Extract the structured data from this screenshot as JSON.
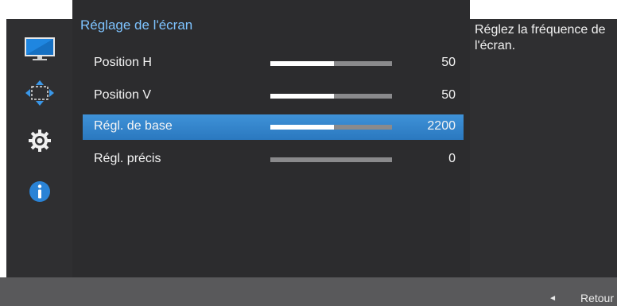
{
  "menu": {
    "title": "Réglage de l'écran",
    "items": [
      {
        "label": "Position H",
        "value": "50",
        "level": 0.52,
        "selected": false
      },
      {
        "label": "Position V",
        "value": "50",
        "level": 0.52,
        "selected": false
      },
      {
        "label": "Régl. de base",
        "value": "2200",
        "level": 0.52,
        "selected": true
      },
      {
        "label": "Régl. précis",
        "value": "0",
        "level": 0.0,
        "selected": false
      }
    ]
  },
  "sidebar": {
    "icons": [
      "monitor-icon",
      "arrows-move-icon",
      "gear-icon",
      "info-icon"
    ]
  },
  "description": {
    "text": "Réglez la fréquence de l'écran."
  },
  "footer": {
    "back_label": "Retour"
  },
  "colors": {
    "accent": "#2f86cf",
    "title": "#7ec3ff",
    "panel": "#2c2c2e",
    "footer": "#59595b"
  }
}
